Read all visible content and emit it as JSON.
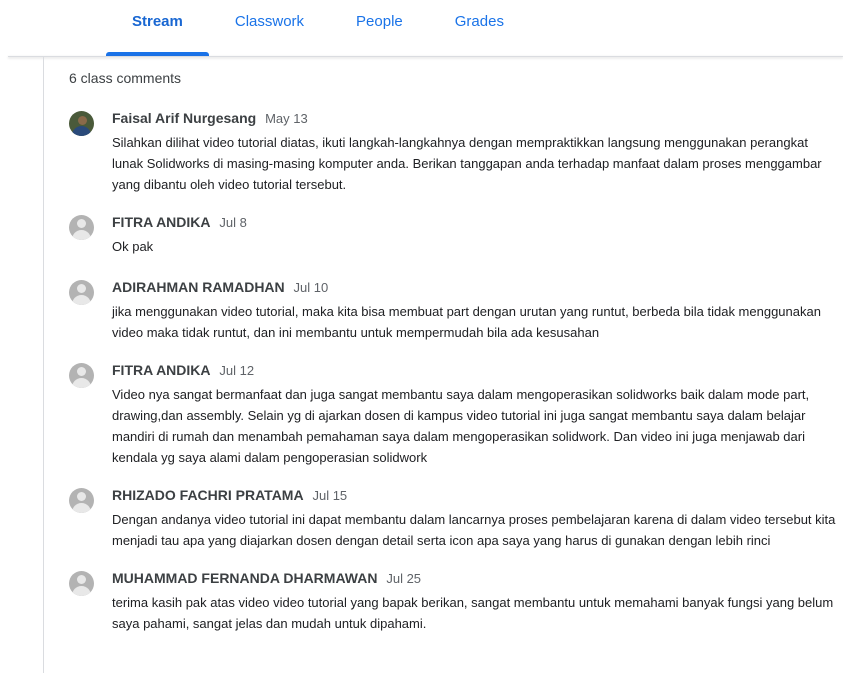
{
  "tabs": [
    {
      "label": "Stream",
      "active": true
    },
    {
      "label": "Classwork",
      "active": false
    },
    {
      "label": "People",
      "active": false
    },
    {
      "label": "Grades",
      "active": false
    }
  ],
  "comment_count": "6 class comments",
  "comments": [
    {
      "author": "Faisal Arif Nurgesang",
      "date": "May 13",
      "avatar": "profile-photo",
      "text": "Silahkan dilihat video tutorial diatas, ikuti langkah-langkahnya dengan mempraktikkan langsung menggunakan perangkat lunak Solidworks di masing-masing komputer anda. Berikan tanggapan anda terhadap manfaat dalam proses menggambar yang dibantu oleh video tutorial tersebut."
    },
    {
      "author": "FITRA ANDIKA",
      "date": "Jul 8",
      "avatar": "default-user-icon",
      "text": "Ok pak"
    },
    {
      "author": "ADIRAHMAN RAMADHAN",
      "date": "Jul 10",
      "avatar": "default-user-icon",
      "text": "jika menggunakan video tutorial, maka kita bisa membuat part dengan urutan yang runtut, berbeda bila tidak menggunakan video maka tidak runtut, dan ini membantu untuk mempermudah bila ada kesusahan"
    },
    {
      "author": "FITRA ANDIKA",
      "date": "Jul 12",
      "avatar": "default-user-icon",
      "text": "Video nya sangat bermanfaat dan juga sangat membantu saya dalam mengoperasikan solidworks baik dalam mode part, drawing,dan assembly. Selain yg di ajarkan dosen di kampus video tutorial ini juga sangat membantu saya dalam belajar mandiri di rumah dan menambah pemahaman saya dalam mengoperasikan solidwork. Dan video ini juga menjawab dari kendala yg saya alami dalam pengoperasian solidwork"
    },
    {
      "author": "RHIZADO FACHRI PRATAMA",
      "date": "Jul 15",
      "avatar": "default-user-icon",
      "text": "Dengan andanya video tutorial ini dapat membantu dalam lancarnya proses pembelajaran karena di dalam video tersebut kita menjadi tau apa yang diajarkan dosen dengan detail serta icon apa saya yang harus di gunakan dengan lebih rinci"
    },
    {
      "author": "MUHAMMAD FERNANDA DHARMAWAN",
      "date": "Jul 25",
      "avatar": "default-user-icon",
      "text": "terima kasih pak atas video video tutorial yang bapak berikan, sangat membantu untuk memahami banyak fungsi yang belum saya pahami, sangat jelas dan mudah untuk dipahami."
    }
  ],
  "colors": {
    "accent": "#1a73e8",
    "text": "#202124",
    "muted": "#5f6368",
    "divider": "#dadce0"
  }
}
